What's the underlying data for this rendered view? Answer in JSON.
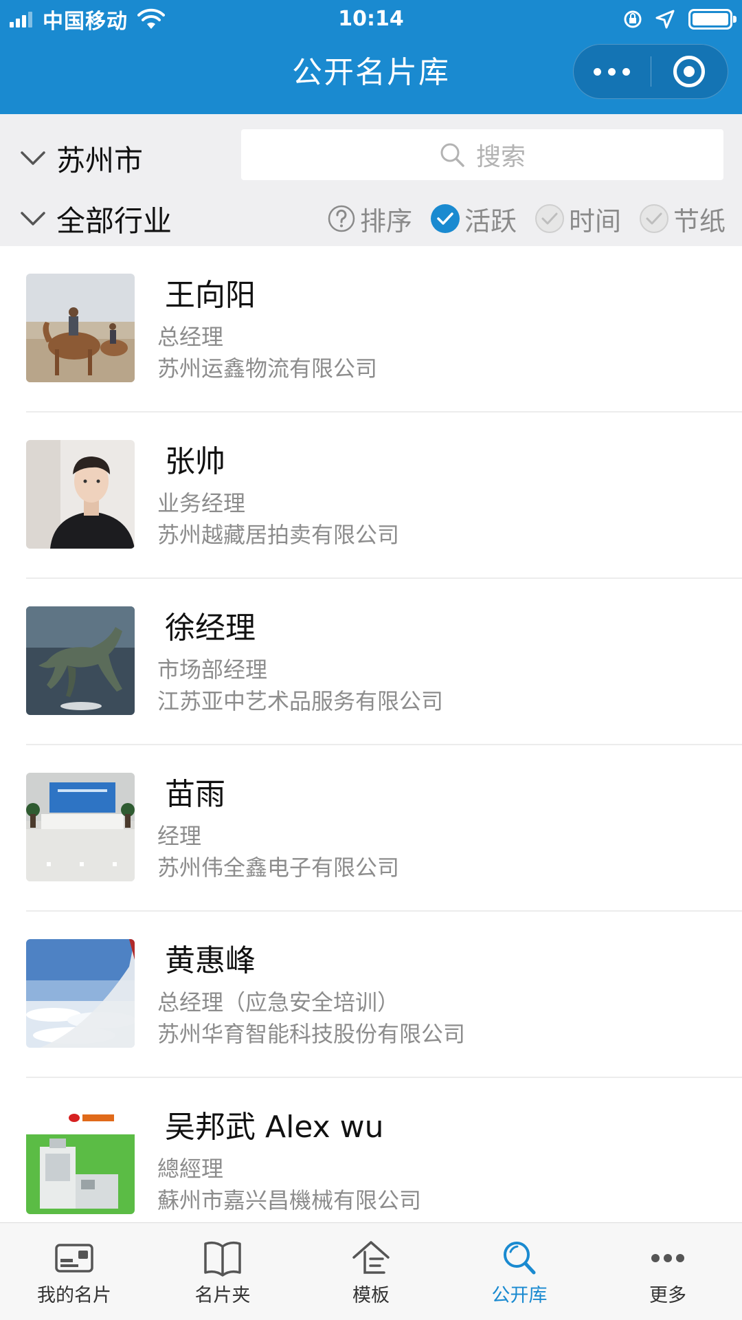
{
  "status_bar": {
    "carrier": "中国移动",
    "time": "10:14"
  },
  "nav": {
    "title": "公开名片库"
  },
  "filters": {
    "city": "苏州市",
    "industry": "全部行业",
    "search_placeholder": "搜索",
    "sort_options": [
      {
        "label": "排序",
        "icon": "question-circle-icon",
        "active": false
      },
      {
        "label": "活跃",
        "icon": "check-circle-icon",
        "active": true
      },
      {
        "label": "时间",
        "icon": "check-circle-icon",
        "active": false
      },
      {
        "label": "节纸",
        "icon": "check-circle-icon",
        "active": false
      }
    ]
  },
  "cards": [
    {
      "name": "王向阳",
      "title": "总经理",
      "company": "苏州运鑫物流有限公司",
      "avatar": "camel-desert-photo"
    },
    {
      "name": "张帅",
      "title": "业务经理",
      "company": "苏州越藏居拍卖有限公司",
      "avatar": "man-portrait-photo"
    },
    {
      "name": "徐经理",
      "title": "市场部经理",
      "company": "江苏亚中艺术品服务有限公司",
      "avatar": "bronze-horse-photo"
    },
    {
      "name": "苗雨",
      "title": "经理",
      "company": "苏州伟全鑫电子有限公司",
      "avatar": "office-lobby-photo"
    },
    {
      "name": "黄惠峰",
      "title": "总经理（应急安全培训）",
      "company": "苏州华育智能科技股份有限公司",
      "avatar": "airplane-wing-photo"
    },
    {
      "name": "吴邦武 Alex wu",
      "title": "總經理",
      "company": "蘇州市嘉兴昌機械有限公司",
      "avatar": "machine-product-photo"
    }
  ],
  "tabbar": [
    {
      "label": "我的名片",
      "icon": "card-icon",
      "active": false
    },
    {
      "label": "名片夹",
      "icon": "book-icon",
      "active": false
    },
    {
      "label": "模板",
      "icon": "template-house-icon",
      "active": false
    },
    {
      "label": "公开库",
      "icon": "search-icon",
      "active": true
    },
    {
      "label": "更多",
      "icon": "more-dots-icon",
      "active": false
    }
  ],
  "colors": {
    "brand": "#1a8ad0",
    "filter_bg": "#efeff1",
    "secondary_text": "#8c8c8c",
    "active_check": "#1a8ad0"
  }
}
